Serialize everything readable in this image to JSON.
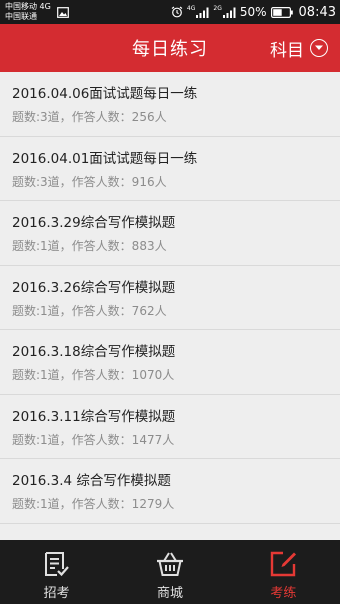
{
  "status_bar": {
    "carrier_1": "中国移动 4G",
    "carrier_2": "中国联通",
    "net_1": "4G",
    "net_2": "2G",
    "battery": "50%",
    "time": "08:43"
  },
  "header": {
    "title": "每日练习",
    "subject_label": "科目",
    "background": "#d42c31"
  },
  "list": {
    "items": [
      {
        "title": "2016.04.06面试试题每日一练",
        "meta": "题数:3道，作答人数：256人"
      },
      {
        "title": "2016.04.01面试试题每日一练",
        "meta": "题数:3道，作答人数：916人"
      },
      {
        "title": "2016.3.29综合写作模拟题",
        "meta": "题数:1道，作答人数：883人"
      },
      {
        "title": "2016.3.26综合写作模拟题",
        "meta": "题数:1道，作答人数：762人"
      },
      {
        "title": "2016.3.18综合写作模拟题",
        "meta": "题数:1道，作答人数：1070人"
      },
      {
        "title": "2016.3.11综合写作模拟题",
        "meta": "题数:1道，作答人数：1477人"
      },
      {
        "title": "2016.3.4 综合写作模拟题",
        "meta": "题数:1道，作答人数：1279人"
      }
    ]
  },
  "bottom_nav": {
    "tabs": [
      {
        "label": "招考",
        "icon": "exam-list-icon"
      },
      {
        "label": "商城",
        "icon": "shopping-basket-icon"
      },
      {
        "label": "考练",
        "icon": "practice-edit-icon",
        "active": true
      }
    ],
    "active_color": "#e53935"
  }
}
